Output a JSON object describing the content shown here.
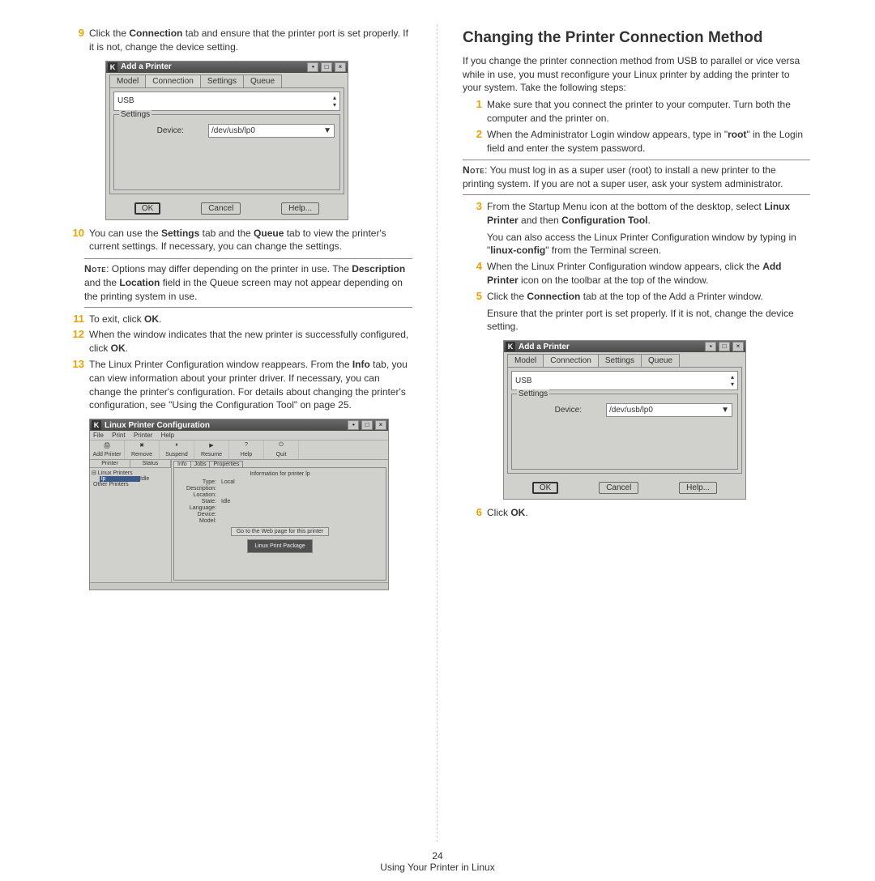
{
  "footer": {
    "page_num": "24",
    "section": "Using Your Printer in Linux"
  },
  "left": {
    "step9": {
      "n": "9",
      "t1": "Click the ",
      "b1": "Connection",
      "t2": " tab and ensure that the printer port is set properly. If it is not, change the device setting."
    },
    "step10": {
      "n": "10",
      "t1": "You can use the ",
      "b1": "Settings",
      "t2": " tab and the ",
      "b2": "Queue",
      "t3": " tab to view the printer's current settings. If necessary, you can change the settings."
    },
    "note1": {
      "label": "Note",
      "t1": ": Options may differ depending on the printer in use. The ",
      "b1": "Description",
      "t2": " and the ",
      "b2": "Location",
      "t3": " field in the Queue screen may not appear depending on the printing system in use."
    },
    "step11": {
      "n": "11",
      "t1": "To exit, click ",
      "b1": "OK",
      "t2": "."
    },
    "step12": {
      "n": "12",
      "t1": "When the window indicates that the new printer is successfully configured, click ",
      "b1": "OK",
      "t2": "."
    },
    "step13": {
      "n": "13",
      "t1": "The Linux Printer Configuration window reappears. From the ",
      "b1": "Info",
      "t2": " tab, you can view information about your printer driver. If necessary, you can change the printer's configuration. For details about changing the printer's configuration, see \"Using the Configuration Tool\" on page 25."
    }
  },
  "right": {
    "heading": "Changing the Printer Connection Method",
    "intro": "If you change the printer connection method from USB to parallel or vice versa while in use, you must reconfigure your Linux printer by adding the printer to your system. Take the following steps:",
    "step1": {
      "n": "1",
      "t": "Make sure that you connect the printer to your computer. Turn both the computer and the printer on."
    },
    "step2": {
      "n": "2",
      "t1": "When the Administrator Login window appears, type in \"",
      "b1": "root",
      "t2": "\" in the Login field and enter the system password."
    },
    "note": {
      "label": "Note",
      "t": ": You must log in as a super user (root) to install a new printer to the printing system. If you are not a super user, ask your system administrator."
    },
    "step3": {
      "n": "3",
      "t1": "From the Startup Menu icon at the bottom of the desktop, select ",
      "b1": "Linux Printer",
      "t2": " and then ",
      "b2": "Configuration Tool",
      "t3": ".",
      "p2a": "You can also access the Linux Printer Configuration window by typing in \"",
      "p2b": "linux-config",
      "p2c": "\" from the Terminal screen."
    },
    "step4": {
      "n": "4",
      "t1": "When the Linux Printer Configuration window appears, click the ",
      "b1": "Add Printer",
      "t2": " icon on the toolbar at the top of the window."
    },
    "step5": {
      "n": "5",
      "t1": "Click the ",
      "b1": "Connection",
      "t2": " tab at the top of the Add a Printer window.",
      "p2": "Ensure that the printer port is set properly. If it is not, change the device setting."
    },
    "step6": {
      "n": "6",
      "t1": "Click ",
      "b1": "OK",
      "t2": "."
    }
  },
  "dlg": {
    "k": "K",
    "title": "Add a Printer",
    "tab0": "Model",
    "tab1": "Connection",
    "tab2": "Settings",
    "tab3": "Queue",
    "combo": "USB",
    "fieldset": "Settings",
    "device_lbl": "Device:",
    "device_val": "/dev/usb/lp0",
    "ok": "OK",
    "cancel": "Cancel",
    "help": "Help...",
    "dot": "•",
    "sq": "□",
    "x": "×",
    "up": "▴",
    "dn": "▾",
    "drop": "▼"
  },
  "cfg": {
    "title": "Linux Printer Configuration",
    "menu": {
      "file": "File",
      "print": "Print",
      "printer": "Printer",
      "help": "Help"
    },
    "tb": {
      "add": "Add Printer",
      "remove": "Remove",
      "suspend": "Suspend",
      "resume": "Resume",
      "help": "Help",
      "quit": "Quit"
    },
    "tree": {
      "h1": "Printer",
      "h2": "Status",
      "n1": "⊟ Linux Printers",
      "n2": "lp",
      "n2s": "Idle",
      "n3": "Other Printers"
    },
    "tabs": {
      "info": "Info",
      "jobs": "Jobs",
      "prop": "Properties"
    },
    "panel": {
      "title": "Information for printer lp",
      "r": [
        {
          "l": "Type:",
          "v": "Local"
        },
        {
          "l": "Description:",
          "v": ""
        },
        {
          "l": "Location:",
          "v": ""
        },
        {
          "l": "State:",
          "v": "Idle"
        },
        {
          "l": "Language:",
          "v": ""
        },
        {
          "l": "Device:",
          "v": ""
        },
        {
          "l": "Model:",
          "v": ""
        }
      ],
      "webbtn": "Go to the Web page for this printer",
      "logo": "Linux Print Package"
    }
  }
}
